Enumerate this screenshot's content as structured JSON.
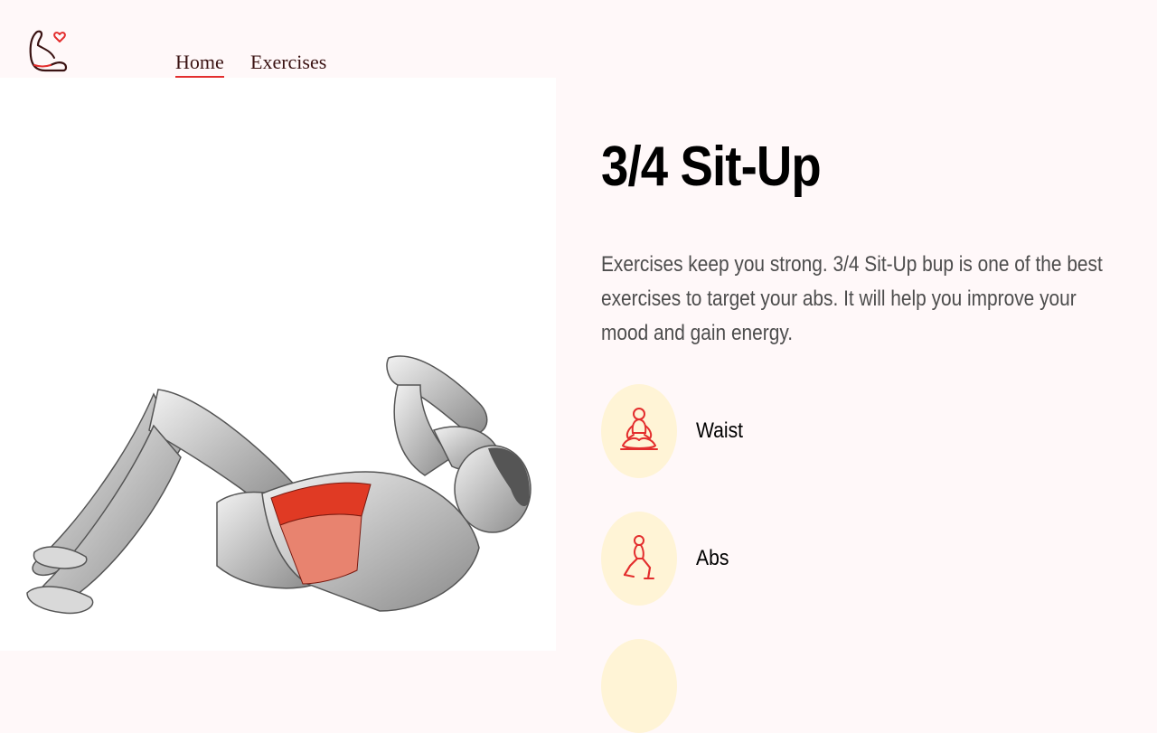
{
  "navbar": {
    "logo_icon": "flexed-arm-heart-icon",
    "links": [
      {
        "label": "Home",
        "active": true
      },
      {
        "label": "Exercises",
        "active": false
      }
    ],
    "accent_color": "#e32d2d"
  },
  "exercise": {
    "image_icon": "sit-up-muscle-illustration",
    "name": "3/4 Sit-Up",
    "description": "Exercises keep you strong. 3/4 Sit-Up bup is one of the best exercises to target your abs. It will help you improve your mood and gain energy.",
    "tags": [
      {
        "label": "Waist",
        "icon": "meditation-pose-icon"
      },
      {
        "label": "Abs",
        "icon": "lunge-pose-icon"
      },
      {
        "label": "",
        "icon": "body-part-icon"
      }
    ],
    "tag_bg_color": "#fff4d6",
    "icon_color": "#e32d2d"
  }
}
